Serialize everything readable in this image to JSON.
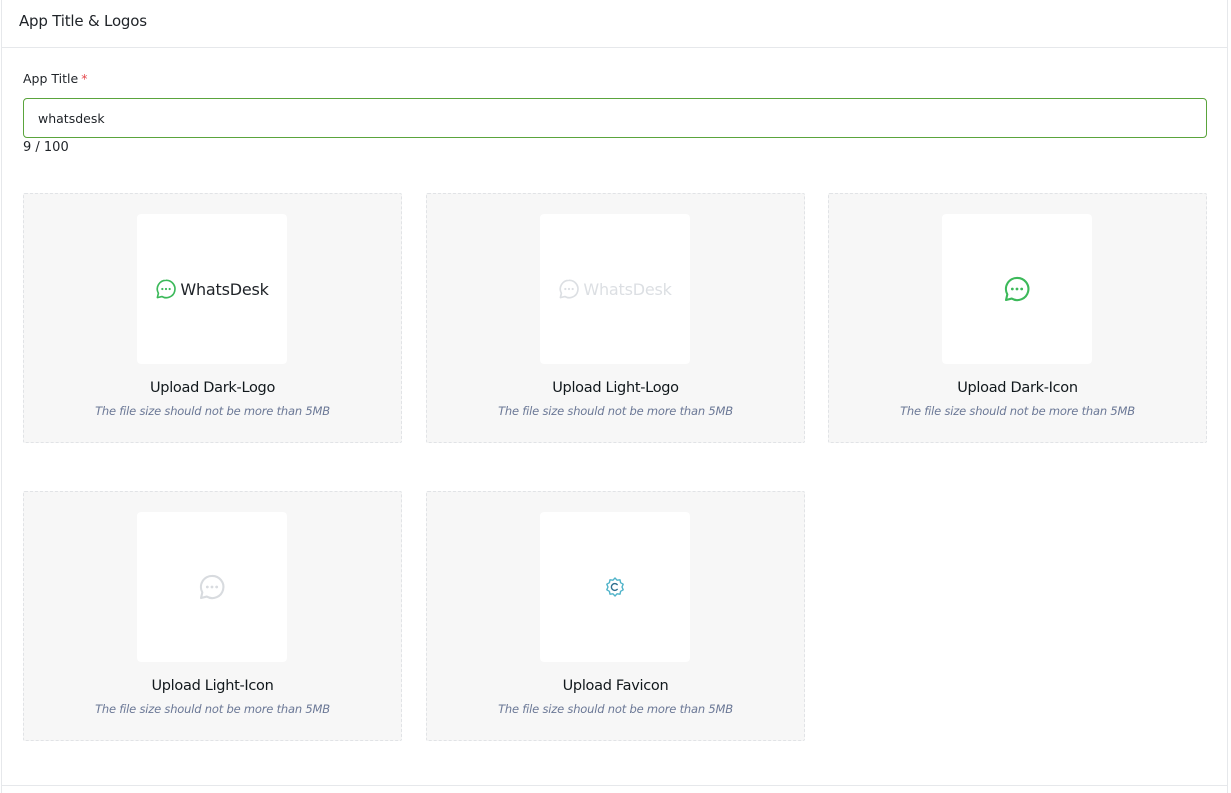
{
  "header": {
    "title": "App Title & Logos"
  },
  "app_title_field": {
    "label": "App Title",
    "required_mark": "*",
    "value": "whatsdesk",
    "counter": "9 / 100"
  },
  "uploads": [
    {
      "title": "Upload Dark-Logo",
      "hint": "The file size should not be more than 5MB",
      "preview_text": "WhatsDesk",
      "preview_icon": "chat-bubble-icon",
      "color": "#3cb95a"
    },
    {
      "title": "Upload Light-Logo",
      "hint": "The file size should not be more than 5MB",
      "preview_text": "WhatsDesk",
      "preview_icon": "chat-bubble-icon",
      "color": "#dcdfe3"
    },
    {
      "title": "Upload Dark-Icon",
      "hint": "The file size should not be more than 5MB",
      "preview_icon": "chat-bubble-icon",
      "color": "#3cb95a"
    },
    {
      "title": "Upload Light-Icon",
      "hint": "The file size should not be more than 5MB",
      "preview_icon": "chat-bubble-icon",
      "color": "#d8dbdf"
    },
    {
      "title": "Upload Favicon",
      "hint": "The file size should not be more than 5MB",
      "preview_icon": "gear-favicon-icon",
      "color": "#4fb3c9"
    }
  ],
  "colors": {
    "accent_border": "#5aa43c",
    "required": "#e5484d"
  }
}
